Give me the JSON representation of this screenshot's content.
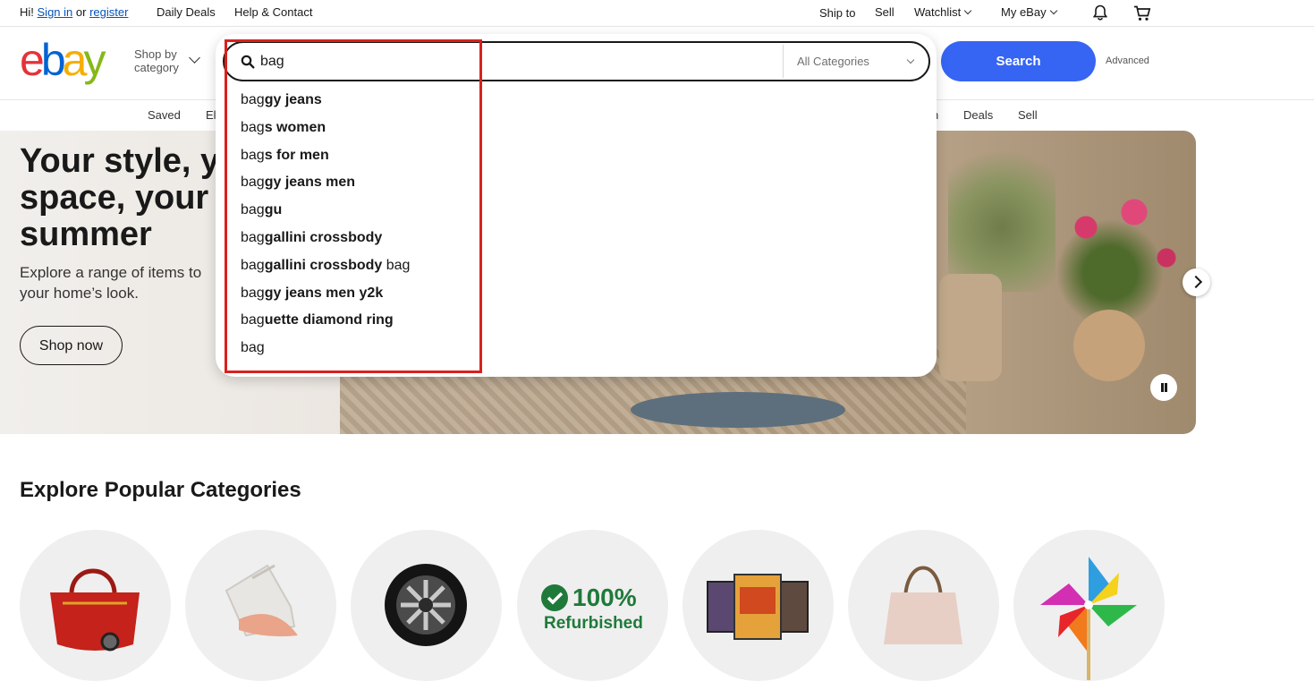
{
  "topbar": {
    "greeting": "Hi!",
    "sign_in": "Sign in",
    "or": "or",
    "register": "register",
    "daily_deals": "Daily Deals",
    "help_contact": "Help & Contact",
    "ship_to": "Ship to",
    "sell": "Sell",
    "watchlist": "Watchlist",
    "my_ebay": "My eBay"
  },
  "header": {
    "logo_letters": [
      "e",
      "b",
      "a",
      "y"
    ],
    "logo_colors": [
      "#e53238",
      "#0064d2",
      "#f5af02",
      "#86b817"
    ],
    "shop_by_line1": "Shop by",
    "shop_by_line2": "category"
  },
  "search": {
    "query": "bag",
    "category": "All Categories",
    "button_label": "Search",
    "advanced": "Advanced",
    "accent_color": "#3665f3"
  },
  "nav": {
    "items": [
      "Saved",
      "El",
      "n",
      "Deals",
      "Sell"
    ]
  },
  "suggestions": [
    {
      "prefix": "bag",
      "bold": "gy jeans",
      "rest": ""
    },
    {
      "prefix": "bag",
      "bold": "s women",
      "rest": ""
    },
    {
      "prefix": "bag",
      "bold": "s for men",
      "rest": ""
    },
    {
      "prefix": "bag",
      "bold": "gy jeans men",
      "rest": ""
    },
    {
      "prefix": "bag",
      "bold": "gu",
      "rest": ""
    },
    {
      "prefix": "bag",
      "bold": "gallini crossbody",
      "rest": ""
    },
    {
      "prefix": "bag",
      "bold": "gallini crossbody",
      "rest": " bag"
    },
    {
      "prefix": "bag",
      "bold": "gy jeans men y2k",
      "rest": ""
    },
    {
      "prefix": "bag",
      "bold": "uette diamond ring",
      "rest": ""
    },
    {
      "prefix": "bag",
      "bold": "",
      "rest": ""
    }
  ],
  "hero": {
    "title": "Your style, y\nspace, your\nsummer",
    "subtitle": "Explore a range of items to\nyour home’s look.",
    "cta": "Shop now"
  },
  "categories": {
    "title": "Explore Popular Categories",
    "refurbished_percent": "100%",
    "refurbished_label": "Refurbished",
    "refurbished_color": "#1f7a3a",
    "items": [
      "red-handbag",
      "sneakers",
      "car-wheel",
      "refurbished-badge",
      "trading-cards",
      "beige-handbag",
      "pinwheel-toy"
    ]
  }
}
